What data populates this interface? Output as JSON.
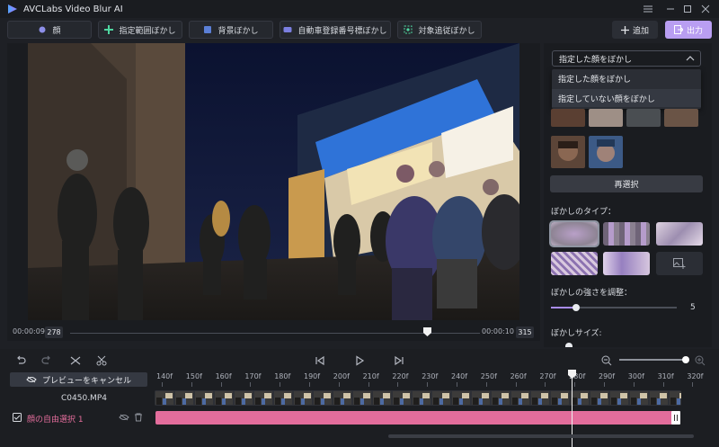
{
  "app": {
    "title": "AVCLabs Video Blur AI"
  },
  "toolbar": {
    "tabs": [
      {
        "label": "顔",
        "icon": "face-icon"
      },
      {
        "label": "指定範囲ぼかし",
        "icon": "region-icon"
      },
      {
        "label": "背景ぼかし",
        "icon": "background-icon"
      },
      {
        "label": "自動車登録番号標ぼかし",
        "icon": "license-plate-icon"
      },
      {
        "label": "対象追従ぼかし",
        "icon": "tracking-icon"
      }
    ],
    "add_label": "追加",
    "output_label": "出力"
  },
  "preview": {
    "current_time": "00:00:09",
    "current_frame": "278",
    "end_time": "00:00:10",
    "end_frame": "315"
  },
  "panel": {
    "dropdown_value": "指定した顔をぼかし",
    "dropdown_options": [
      "指定した顔をぼかし",
      "指定していない顔をぼかし"
    ],
    "reselect_label": "再選択",
    "blur_type_label": "ぼかしのタイプ：",
    "strength_label": "ぼかしの強さを調整：",
    "strength_value": "5",
    "size_label": "ぼかしサイズ:"
  },
  "timeline": {
    "cancel_preview_label": "プレビューをキャンセル",
    "clip_name": "C0450.MP4",
    "track_label": "顔の自由選択 1",
    "ticks": [
      "140f",
      "150f",
      "160f",
      "170f",
      "180f",
      "190f",
      "200f",
      "210f",
      "220f",
      "230f",
      "240f",
      "250f",
      "260f",
      "270f",
      "280f",
      "290f",
      "300f",
      "310f",
      "320f"
    ]
  },
  "colors": {
    "accent": "#b99ef2",
    "track": "#e36d9c",
    "background": "#1e2025"
  }
}
